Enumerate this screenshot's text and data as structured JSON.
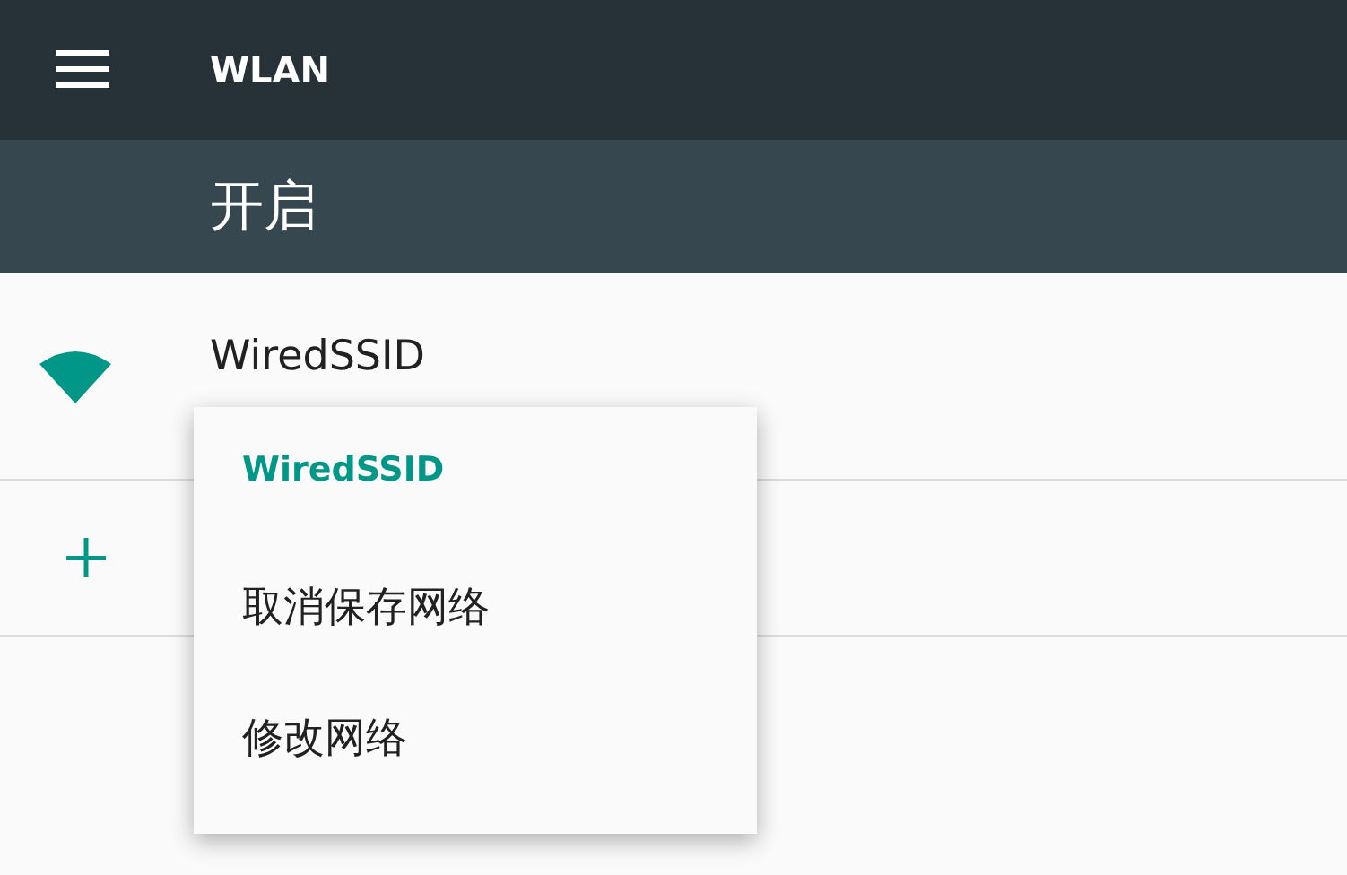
{
  "toolbar": {
    "title": "WLAN"
  },
  "switch_bar": {
    "label": "开启"
  },
  "networks": [
    {
      "kind": "wifi",
      "name": "WiredSSID"
    },
    {
      "kind": "add"
    }
  ],
  "menu": {
    "title": "WiredSSID",
    "items": [
      "取消保存网络",
      "修改网络"
    ]
  }
}
